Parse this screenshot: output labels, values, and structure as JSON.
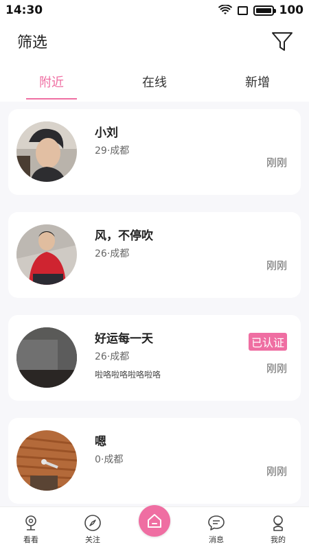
{
  "status_bar": {
    "time": "14:30",
    "battery": "100"
  },
  "header": {
    "title": "筛选",
    "filter_icon": "filter-funnel-icon"
  },
  "tabs": [
    {
      "label": "附近",
      "active": true
    },
    {
      "label": "在线",
      "active": false
    },
    {
      "label": "新增",
      "active": false
    }
  ],
  "users": [
    {
      "name": "小刘",
      "meta": "29·成都",
      "signature": "",
      "time": "刚刚",
      "badge": ""
    },
    {
      "name": "风，不停吹",
      "meta": "26·成都",
      "signature": "",
      "time": "刚刚",
      "badge": ""
    },
    {
      "name": "好运每一天",
      "meta": "26·成都",
      "signature": "啦咯啦咯啦咯啦咯",
      "time": "刚刚",
      "badge": "已认证"
    },
    {
      "name": "嗯",
      "meta": "0·成都",
      "signature": "",
      "time": "刚刚",
      "badge": ""
    }
  ],
  "bottom_nav": [
    {
      "label": "看看",
      "icon": "location-pin-icon"
    },
    {
      "label": "关注",
      "icon": "compass-icon"
    },
    {
      "label": "",
      "icon": "home-icon"
    },
    {
      "label": "消息",
      "icon": "message-bubble-icon"
    },
    {
      "label": "我的",
      "icon": "profile-icon"
    }
  ],
  "colors": {
    "accent": "#ef6ea2",
    "background": "#f7f7fa"
  }
}
